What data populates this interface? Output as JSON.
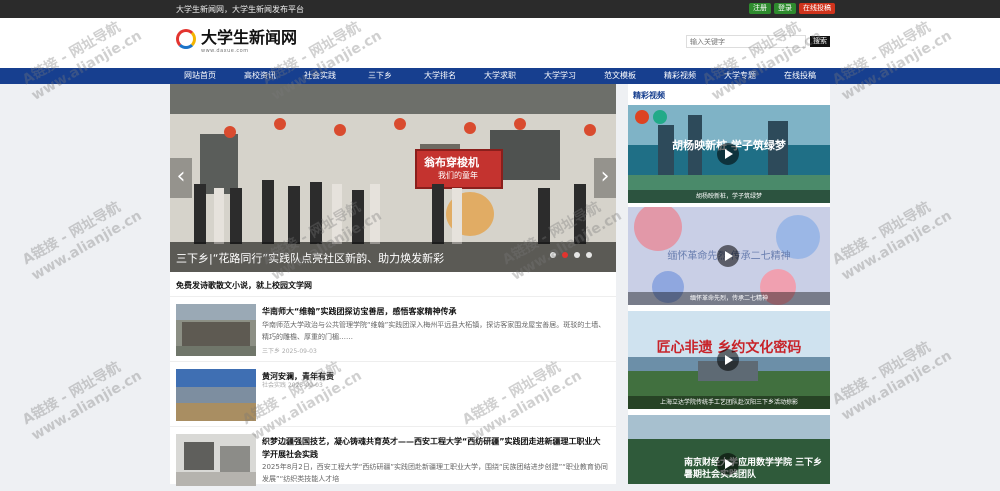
{
  "topbar": {
    "slogan": "大学生新闻网，大学生新闻发布平台",
    "register": "注册",
    "login": "登录",
    "submit": "在线投稿"
  },
  "header": {
    "logo_text": "大学生新闻网",
    "logo_url": "www.daxue.com",
    "search_placeholder": "输入关键字",
    "search_button": "搜索"
  },
  "nav": [
    "网站首页",
    "高校资讯",
    "社会实践",
    "三下乡",
    "大学排名",
    "大学求职",
    "大学学习",
    "范文模板",
    "精彩视频",
    "大学专题",
    "在线投稿"
  ],
  "slider": {
    "caption": "三下乡|“花路同行”实践队点亮社区新韵、助力焕发新彩",
    "wall_text_1": "翁布穿梭机",
    "wall_text_2": "我们的童年",
    "active_dot": 1,
    "dot_count": 4
  },
  "news": {
    "heading": "免费发诗歌散文小说，就上校园文学网",
    "items": [
      {
        "title": "华南师大“维翰”实践团探访宝善居，感悟客家精神传承",
        "desc": "华南师范大学政治与公共管理学院“维翰”实践团深入梅州平远县大柘镇，探访客家围龙屋宝善居。斑驳的土墙、精巧的雕檐、厚重的门楣……",
        "meta": "三下乡  2025-09-03"
      },
      {
        "title": "黄河安澜，青年有责",
        "desc": "",
        "meta": "社会实践  2025-09-03"
      },
      {
        "title": "织梦边疆强国技艺，凝心铸魂共育英才——西安工程大学“西纺研疆”实践团走进新疆理工职业大学开展社会实践",
        "desc": "2025年8月2日，西安工程大学“西纺研疆”实践团赴新疆理工职业大学，围绕“民族团结进步创建”“职业教育协同发展”“纺织类技能人才培",
        "meta": ""
      }
    ]
  },
  "side": {
    "heading": "精彩视频",
    "videos": [
      {
        "caption": "胡杨映新桩，学子筑绿梦",
        "overlay": "胡杨映新桩 学子筑绿梦"
      },
      {
        "caption": "缅怀革命先烈，传承二七精神",
        "overlay": "缅怀革命先烈 传承二七精神"
      },
      {
        "caption": "上海立达学院传统手工艺团队赴汉阳三下乡活动掠影",
        "overlay": "匠心非遗 乡约文化密码"
      },
      {
        "caption": "",
        "overlay": "南京财经大学应用数学学院 三下乡暑期社会实践团队"
      }
    ]
  },
  "watermark": {
    "line1": "A链接 - 网址导航",
    "line2": "www.alianjie.cn"
  }
}
